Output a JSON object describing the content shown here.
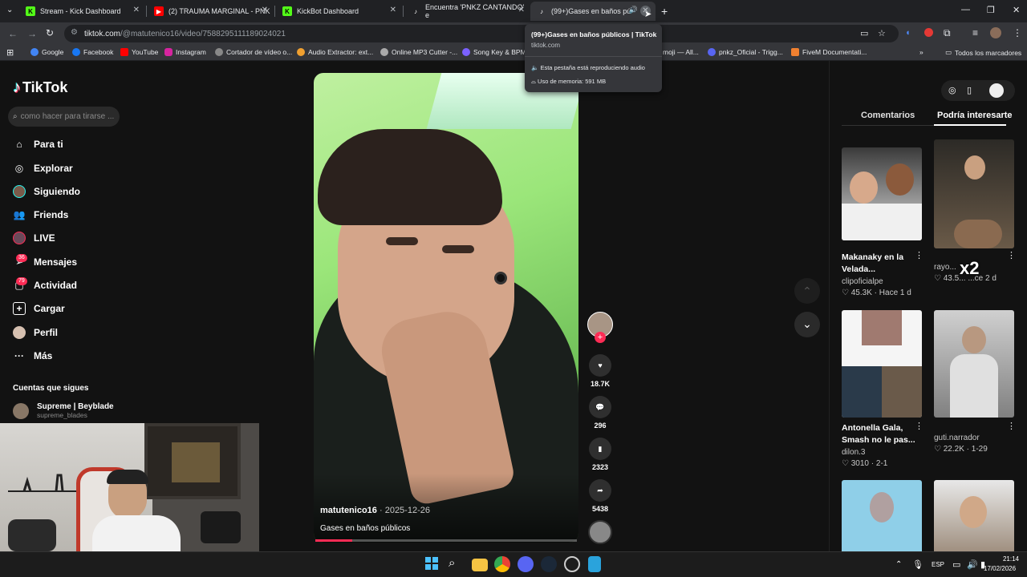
{
  "browser": {
    "tabs": [
      {
        "label": "Stream - Kick Dashboard"
      },
      {
        "label": "(2) TRAUMA MARGINAL - PNK"
      },
      {
        "label": "KickBot Dashboard"
      },
      {
        "label": "Encuentra 'PNKZ CANTANDO' e"
      },
      {
        "label": "(99+)Gases en baños públic"
      }
    ],
    "url_domain": "tiktok.com",
    "url_path": "/@matutenico16/video/7588295111189024021",
    "bookmarks": [
      "Google",
      "Facebook",
      "YouTube",
      "Instagram",
      "Cortador de vídeo o...",
      "Audio Extractor: ext...",
      "Online MP3 Cutter -...",
      "Song Key & BPM F",
      "moji — All...",
      "pnkz_Oficial - Trigg...",
      "FiveM Documentati..."
    ],
    "all_bookmarks": "Todos los marcadores",
    "tooltip": {
      "title": "(99+)Gases en baños públicos | TikTok",
      "domain": "tiktok.com",
      "audio": "Esta pestaña está reproduciendo audio",
      "memory": "Uso de memoria: 591 MB"
    }
  },
  "sidebar": {
    "logo": "TikTok",
    "search_placeholder": "como hacer para tirarse ...",
    "items": [
      {
        "label": "Para ti"
      },
      {
        "label": "Explorar"
      },
      {
        "label": "Siguiendo"
      },
      {
        "label": "Friends"
      },
      {
        "label": "LIVE"
      },
      {
        "label": "Mensajes",
        "badge": "36"
      },
      {
        "label": "Actividad",
        "badge": "79"
      },
      {
        "label": "Cargar"
      },
      {
        "label": "Perfil"
      },
      {
        "label": "Más"
      }
    ],
    "following_title": "Cuentas que sigues",
    "following": [
      {
        "name": "Supreme | Beyblade",
        "handle": "supreme_blades"
      }
    ]
  },
  "video": {
    "author": "matutenico16",
    "date": "· 2025-12-26",
    "caption": "Gases en baños públicos",
    "progress": 0.14
  },
  "actions": {
    "likes": "18.7K",
    "comments": "296",
    "saves": "2323",
    "shares": "5438"
  },
  "right_panel": {
    "tabs": [
      "Comentarios",
      "Podría interesarte"
    ],
    "cards": [
      {
        "title": "Makanaky en la Velada...",
        "author": "clipoficialpe",
        "likes": "45.3K",
        "time": "Hace 1 d"
      },
      {
        "title": "",
        "author": "rayo...",
        "likes": "43.5...",
        "time": "...ce 2 d"
      },
      {
        "title": "Antonella Gala, Smash no le pas...",
        "author": "dilon.3",
        "likes": "3010",
        "time": "2-1"
      },
      {
        "title": "",
        "author": "guti.narrador",
        "likes": "22.2K",
        "time": "1-29"
      }
    ],
    "overlay_x2": "x2"
  },
  "taskbar": {
    "lang": "ESP",
    "time": "21:14",
    "date": "17/02/2026"
  }
}
